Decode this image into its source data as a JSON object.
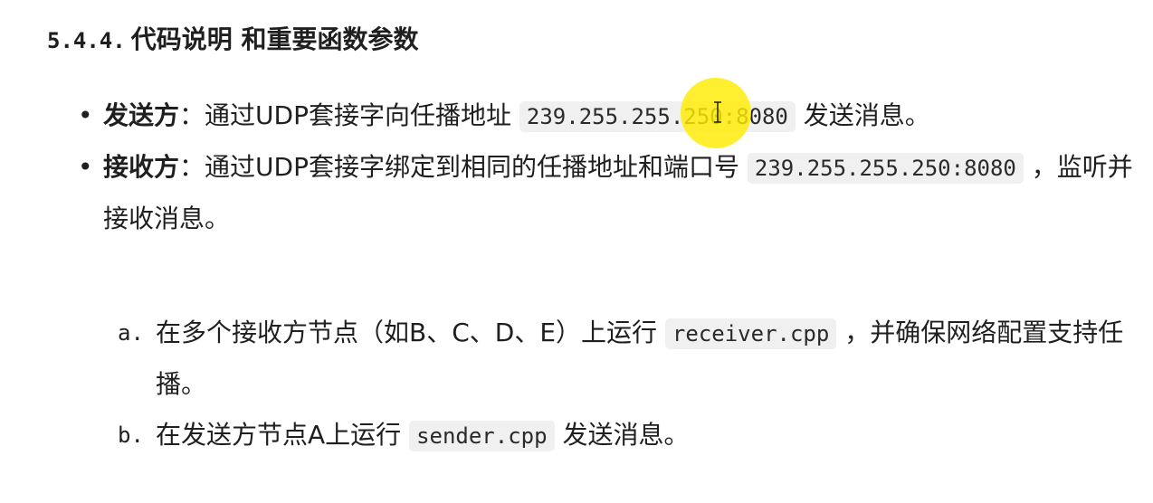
{
  "section": {
    "number": "5.4.4.",
    "title": "代码说明 和重要函数参数"
  },
  "bullets": [
    {
      "label": "发送方",
      "colon": "：",
      "text": "通过UDP套接字向任播地址",
      "code": "239.255.255.250:8080",
      "suffix": "发送消息。"
    },
    {
      "label": "接收方",
      "colon": "：",
      "text": "通过UDP套接字绑定到相同的任播地址和端口号",
      "code": "239.255.255.250:8080",
      "suffix": "，监听并接收消息。"
    }
  ],
  "steps": [
    {
      "marker": "a.",
      "text": "在多个接收方节点（如B、C、D、E）上运行",
      "code": "receiver.cpp",
      "suffix": "，并确保网络配置支持任播。"
    },
    {
      "marker": "b.",
      "text": "在发送方节点A上运行",
      "code": "sender.cpp",
      "suffix": "发送消息。"
    }
  ],
  "colors": {
    "cursor_highlight": "#ffec00",
    "code_background": "#f0f0f0"
  },
  "icons": {
    "cursor": "text-cursor-icon"
  }
}
